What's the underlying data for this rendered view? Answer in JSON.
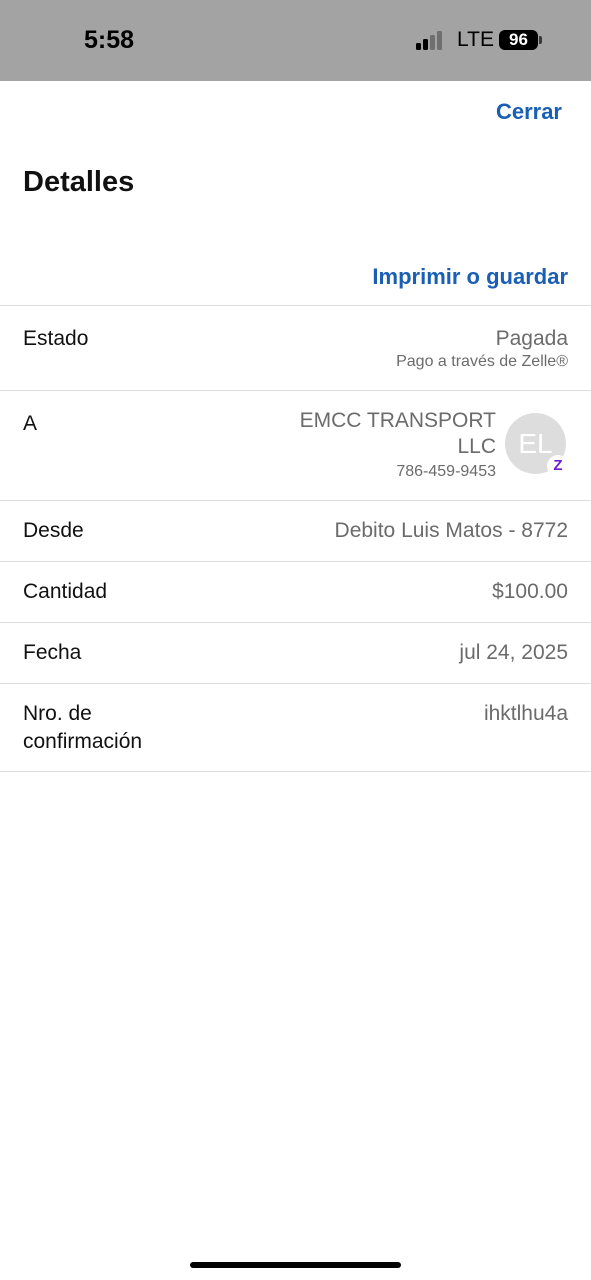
{
  "status_bar": {
    "time": "5:58",
    "network": "LTE",
    "battery": "96"
  },
  "header": {
    "close_label": "Cerrar",
    "title": "Detalles",
    "print_label": "Imprimir o guardar"
  },
  "details": {
    "estado": {
      "label": "Estado",
      "value": "Pagada",
      "sub": "Pago a través de Zelle®"
    },
    "recipient": {
      "label": "A",
      "name": "EMCC TRANSPORT LLC",
      "phone": "786-459-9453",
      "initials": "EL",
      "badge": "Z"
    },
    "desde": {
      "label": "Desde",
      "value": "Debito Luis Matos - 8772"
    },
    "cantidad": {
      "label": "Cantidad",
      "value": "$100.00"
    },
    "fecha": {
      "label": "Fecha",
      "value": "jul 24, 2025"
    },
    "confirmacion": {
      "label": "Nro. de confirmación",
      "value": "ihktlhu4a"
    }
  },
  "colors": {
    "link": "#1a5fb4",
    "zelle": "#6d1ed4",
    "status_bar_bg": "#a3a3a3"
  }
}
